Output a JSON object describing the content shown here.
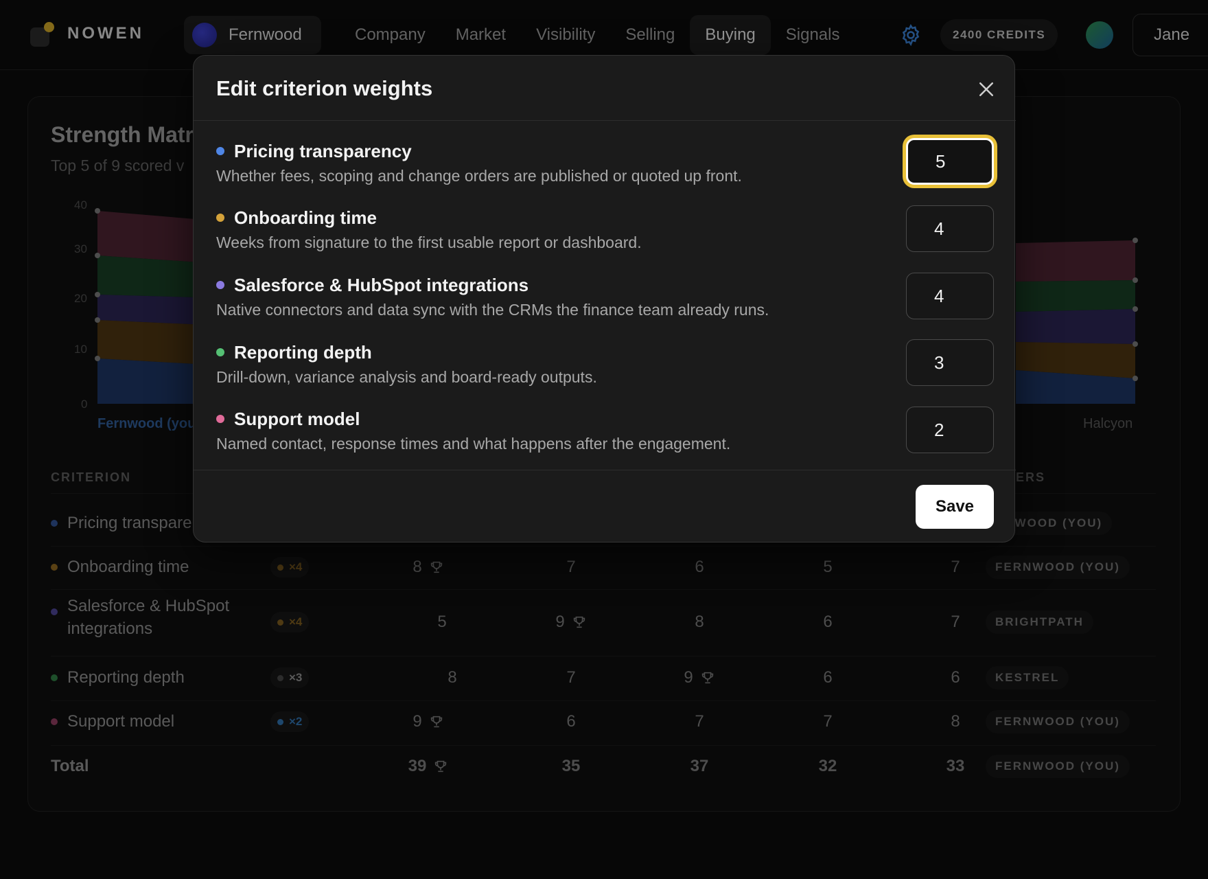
{
  "app": {
    "brand": "NOWEN",
    "project": "Fernwood",
    "nav": [
      "Company",
      "Market",
      "Visibility",
      "Selling",
      "Buying",
      "Signals"
    ],
    "active_nav": "Buying",
    "credits": "2400 CREDITS",
    "user": "Jane"
  },
  "background_card": {
    "title": "Strength Matr",
    "subtitle": "Top 5 of 9 scored v",
    "chart_left_label": "Fernwood (you",
    "chart_right_label": "Halcyon",
    "table": {
      "criterion_header": "CRITERION",
      "leader_header": "DERS",
      "rows": [
        {
          "criterion": "Pricing transpare",
          "color": "#3f6fd8",
          "weight": "",
          "scores": [],
          "leader": "RNWOOD (YOU)"
        },
        {
          "criterion": "Onboarding time",
          "color": "#c08a2a",
          "weight": "×4",
          "weight_color": "#c08a2a",
          "scores": [
            "8",
            "7",
            "6",
            "5",
            "7"
          ],
          "trophy_index": 0,
          "leader": "FERNWOOD (YOU)"
        },
        {
          "criterion": "Salesforce & HubSpot integrations",
          "color": "#6a5ac8",
          "weight": "×4",
          "weight_color": "#c08a2a",
          "scores": [
            "5",
            "9",
            "8",
            "6",
            "7"
          ],
          "trophy_index": 1,
          "leader": "BRIGHTPATH"
        },
        {
          "criterion": "Reporting depth",
          "color": "#3d9a57",
          "weight": "×3",
          "weight_color": "#555555",
          "scores": [
            "8",
            "7",
            "9",
            "6",
            "6"
          ],
          "trophy_index": 2,
          "leader": "KESTREL"
        },
        {
          "criterion": "Support model",
          "color": "#b5507a",
          "weight": "×2",
          "weight_color": "#2f7fc0",
          "scores": [
            "9",
            "6",
            "7",
            "7",
            "8"
          ],
          "trophy_index": 0,
          "leader": "FERNWOOD (YOU)"
        }
      ],
      "total": {
        "label": "Total",
        "scores": [
          "39",
          "35",
          "37",
          "32",
          "33"
        ],
        "trophy_index": 0,
        "leader": "FERNWOOD (YOU)"
      }
    },
    "chart_data": {
      "type": "area",
      "y_ticks": [
        "0",
        "10",
        "20",
        "30",
        "40"
      ],
      "ylim": [
        0,
        40
      ],
      "series_colors": [
        "#2b4a8a",
        "#6e4e1c",
        "#3f3470",
        "#1f5a34",
        "#6a2a44"
      ]
    }
  },
  "modal": {
    "title": "Edit criterion weights",
    "criteria": [
      {
        "name": "Pricing transparency",
        "color": "#4f86e6",
        "description": "Whether fees, scoping and change orders are published or quoted up front.",
        "weight": "5"
      },
      {
        "name": "Onboarding time",
        "color": "#d4a23a",
        "description": "Weeks from signature to the first usable report or dashboard.",
        "weight": "4"
      },
      {
        "name": "Salesforce & HubSpot integrations",
        "color": "#8b7ae0",
        "description": "Native connectors and data sync with the CRMs the finance team already runs.",
        "weight": "4"
      },
      {
        "name": "Reporting depth",
        "color": "#55c074",
        "description": "Drill-down, variance analysis and board-ready outputs.",
        "weight": "3"
      },
      {
        "name": "Support model",
        "color": "#e06b99",
        "description": "Named contact, response times and what happens after the engagement.",
        "weight": "2"
      }
    ],
    "save_label": "Save"
  }
}
